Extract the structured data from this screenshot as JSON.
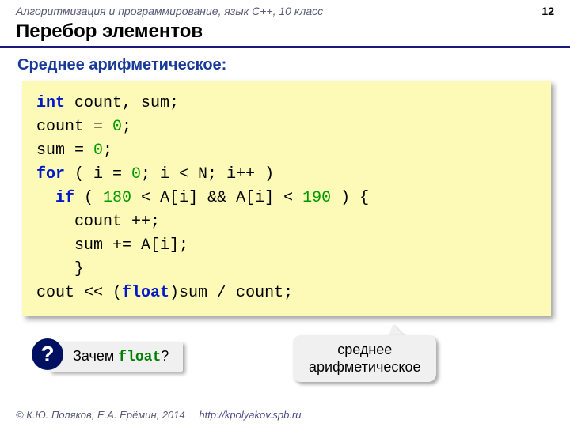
{
  "header": {
    "course": "Алгоритмизация и программирование, язык C++, 10 класс",
    "page": "12"
  },
  "title": "Перебор элементов",
  "subtitle": "Среднее арифметическое:",
  "code": {
    "l1_kw": "int",
    "l1_rest": " count, sum;",
    "l2_a": "count = ",
    "l2_n": "0",
    "l2_b": ";",
    "l3_a": "sum = ",
    "l3_n": "0",
    "l3_b": ";",
    "l4_kw": "for",
    "l4_a": " ( i = ",
    "l4_n": "0",
    "l4_b": "; i < N; i++ )",
    "l5_kw": "if",
    "l5_a": " ( ",
    "l5_n1": "180",
    "l5_b": " < A[i] && A[i] < ",
    "l5_n2": "190",
    "l5_c": " ) {",
    "l6": "    count ++;",
    "l7": "    sum += A[i];",
    "l8": "    }",
    "l9_a": "cout << (",
    "l9_kw": "float",
    "l9_b": ")sum / count;"
  },
  "question": {
    "badge": "?",
    "text_a": "Зачем ",
    "code": "float",
    "text_b": "?"
  },
  "note": {
    "line1": "среднее",
    "line2": "арифметическое"
  },
  "footer": {
    "copyright": "© К.Ю. Поляков, Е.А. Ерёмин, 2014",
    "link": "http://kpolyakov.spb.ru"
  }
}
